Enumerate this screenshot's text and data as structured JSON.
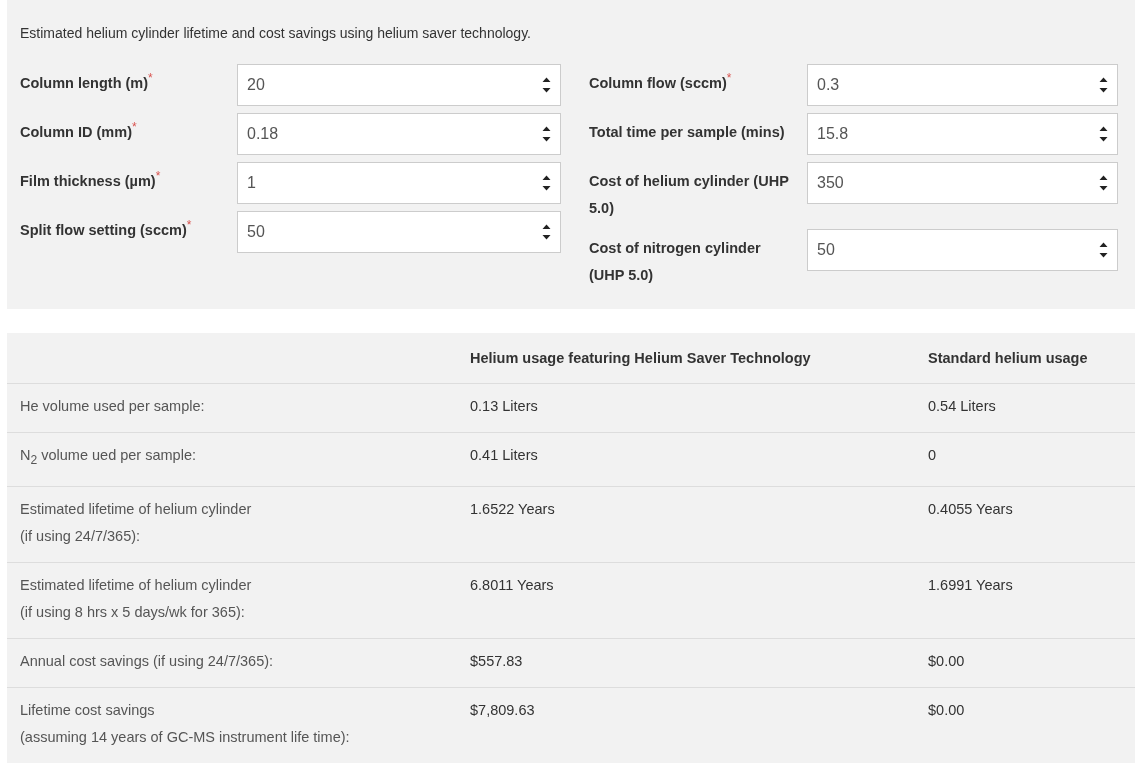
{
  "description": "Estimated helium cylinder lifetime and cost savings using helium saver technology.",
  "fields_left": [
    {
      "label": "Column length (m)",
      "required_mark": "*",
      "value": "20"
    },
    {
      "label": "Column ID (mm)",
      "required_mark": "*",
      "value": "0.18"
    },
    {
      "label": "Film thickness (µm)",
      "required_mark": "*",
      "value": "1"
    },
    {
      "label": "Split flow setting (sccm)",
      "required_mark": "*",
      "value": "50"
    }
  ],
  "fields_right": [
    {
      "label": "Column flow (sccm)",
      "required_mark": "*",
      "value": "0.3"
    },
    {
      "label": "Total time per sample (mins)",
      "value": "15.8"
    },
    {
      "label": "Cost of helium cylinder (UHP 5.0)",
      "value": "350"
    },
    {
      "label": "Cost of nitrogen cylinder (UHP 5.0)",
      "value": "50"
    }
  ],
  "table": {
    "columns": [
      "",
      "Helium usage featuring Helium Saver Technology",
      "Standard helium usage"
    ],
    "rows": [
      {
        "label": [
          "He volume used per sample:"
        ],
        "saver": "0.13 Liters",
        "standard": "0.54 Liters"
      },
      {
        "label": [
          "N$_{2}$ volume ued per sample:"
        ],
        "saver": "0.41 Liters",
        "standard": "0"
      },
      {
        "label": [
          "Estimated lifetime of helium cylinder",
          "(if using 24/7/365):"
        ],
        "saver": "1.6522 Years",
        "standard": "0.4055 Years"
      },
      {
        "label": [
          "Estimated lifetime of helium cylinder",
          "(if using 8 hrs x 5 days/wk for 365):"
        ],
        "saver": "6.8011 Years",
        "standard": "1.6991 Years"
      },
      {
        "label": [
          "Annual cost savings (if using 24/7/365):"
        ],
        "saver": "$557.83",
        "standard": "$0.00"
      },
      {
        "label": [
          "Lifetime cost savings",
          "(assuming 14 years of GC-MS instrument life time):"
        ],
        "saver": "$7,809.63",
        "standard": "$0.00"
      }
    ]
  }
}
